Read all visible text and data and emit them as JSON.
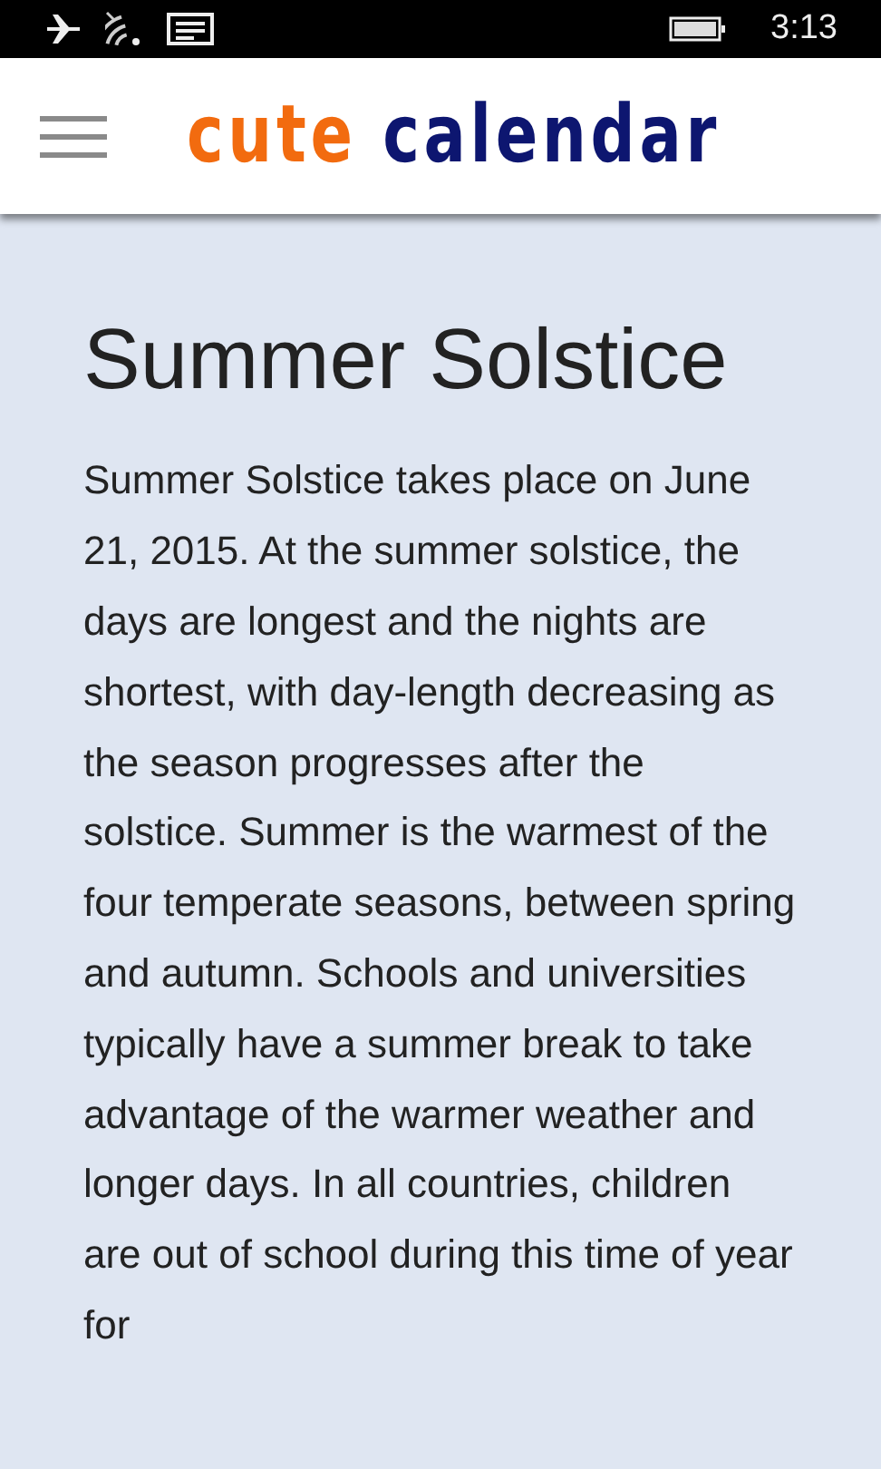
{
  "status_bar": {
    "time": "3:13"
  },
  "header": {
    "logo_words": [
      "cute",
      "calendar"
    ]
  },
  "article": {
    "title": "Summer Solstice",
    "body": "Summer Solstice takes place on June 21, 2015. At the summer solstice, the days are longest and the nights are shortest, with day-length decreasing as the season progresses after the solstice. Summer is the warmest of the four temperate seasons, between spring and autumn. Schools and universities typically have a summer break to take advantage of the warmer weather and longer days. In all countries, children are out of school during this time of year for"
  }
}
